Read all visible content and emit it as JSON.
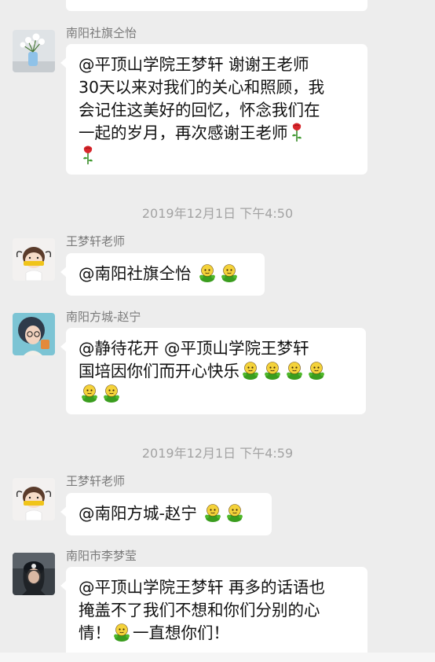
{
  "messages": [
    {
      "sender": "南阳社旗仝怡",
      "lines": [
        "@平顶山学院王梦轩 谢谢王老师",
        "30天以来对我们的关心和照顾，我",
        "会记住这美好的回忆，怀念我们在",
        "一起的岁月，再次感谢王老师"
      ]
    },
    {
      "sender": "王梦轩老师",
      "lines": [
        "@南阳社旗仝怡"
      ]
    },
    {
      "sender": "南阳方城-赵宁",
      "lines": [
        "@静待花开 @平顶山学院王梦轩",
        " 国培因你们而开心快乐"
      ]
    },
    {
      "sender": "王梦轩老师",
      "lines": [
        "@南阳方城-赵宁"
      ]
    },
    {
      "sender": "南阳市李梦莹",
      "lines": [
        "@平顶山学院王梦轩 再多的话语也",
        "掩盖不了我们不想和你们分别的心",
        "情！",
        "一直想你们！"
      ]
    }
  ],
  "timestamps": [
    "2019年12月1日 下午4:50",
    "2019年12月1日 下午4:59"
  ],
  "icons": {
    "emoji": "green-doll-emoji-icon",
    "rose": "rose-emoji-icon"
  },
  "colors": {
    "background": "#ededed",
    "bubble": "#ffffff",
    "sender_text": "#7a7a7a",
    "timestamp_text": "#a3a3a3"
  }
}
